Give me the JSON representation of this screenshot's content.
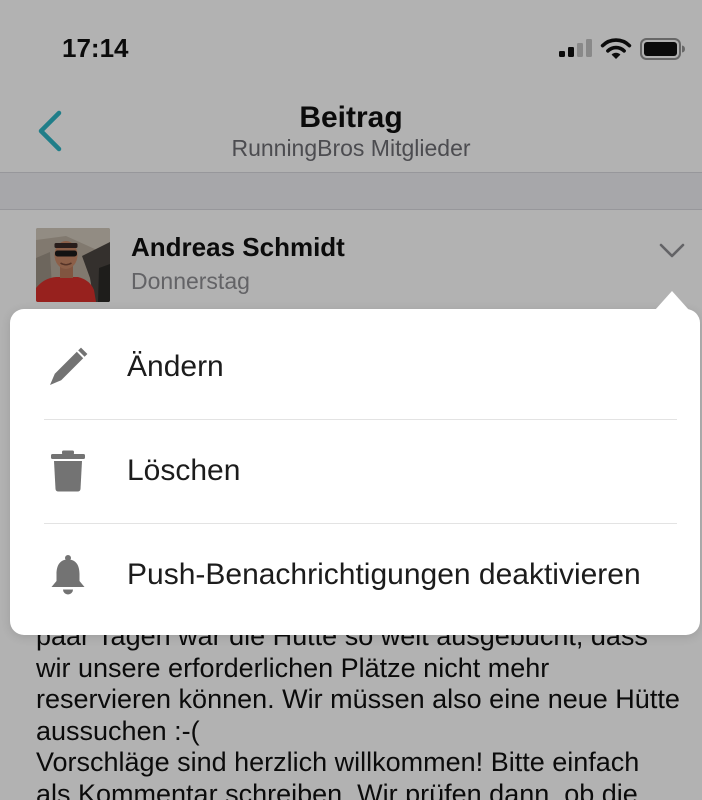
{
  "status_bar": {
    "time": "17:14",
    "icons": [
      "signal-icon",
      "wifi-icon",
      "battery-icon"
    ]
  },
  "nav": {
    "back_icon": "chevron-left-icon",
    "title": "Beitrag",
    "subtitle": "RunningBros Mitglieder"
  },
  "post": {
    "author": "Andreas Schmidt",
    "date": "Donnerstag",
    "options_icon": "chevron-down-icon",
    "body_lines": [
      "paar Tagen war die Hütte so weit ausgebucht, dass",
      "wir unsere erforderlichen Plätze nicht mehr",
      "reservieren können. Wir müssen also eine neue Hütte",
      "aussuchen :-(",
      "Vorschläge sind herzlich willkommen! Bitte einfach",
      "als Kommentar schreiben. Wir prüfen dann, ob die"
    ]
  },
  "menu": {
    "items": [
      {
        "icon": "pencil-icon",
        "label": "Ändern"
      },
      {
        "icon": "trash-icon",
        "label": "Löschen"
      },
      {
        "icon": "bell-icon",
        "label": "Push-Benachrichtigungen deaktivieren"
      }
    ]
  },
  "colors": {
    "accent": "#2fb5c5",
    "dim_overlay": "#0000004d",
    "menu_background": "#ffffff",
    "menu_icon": "#737373",
    "page_background": "#ffffff",
    "section_band": "#efeff4"
  }
}
